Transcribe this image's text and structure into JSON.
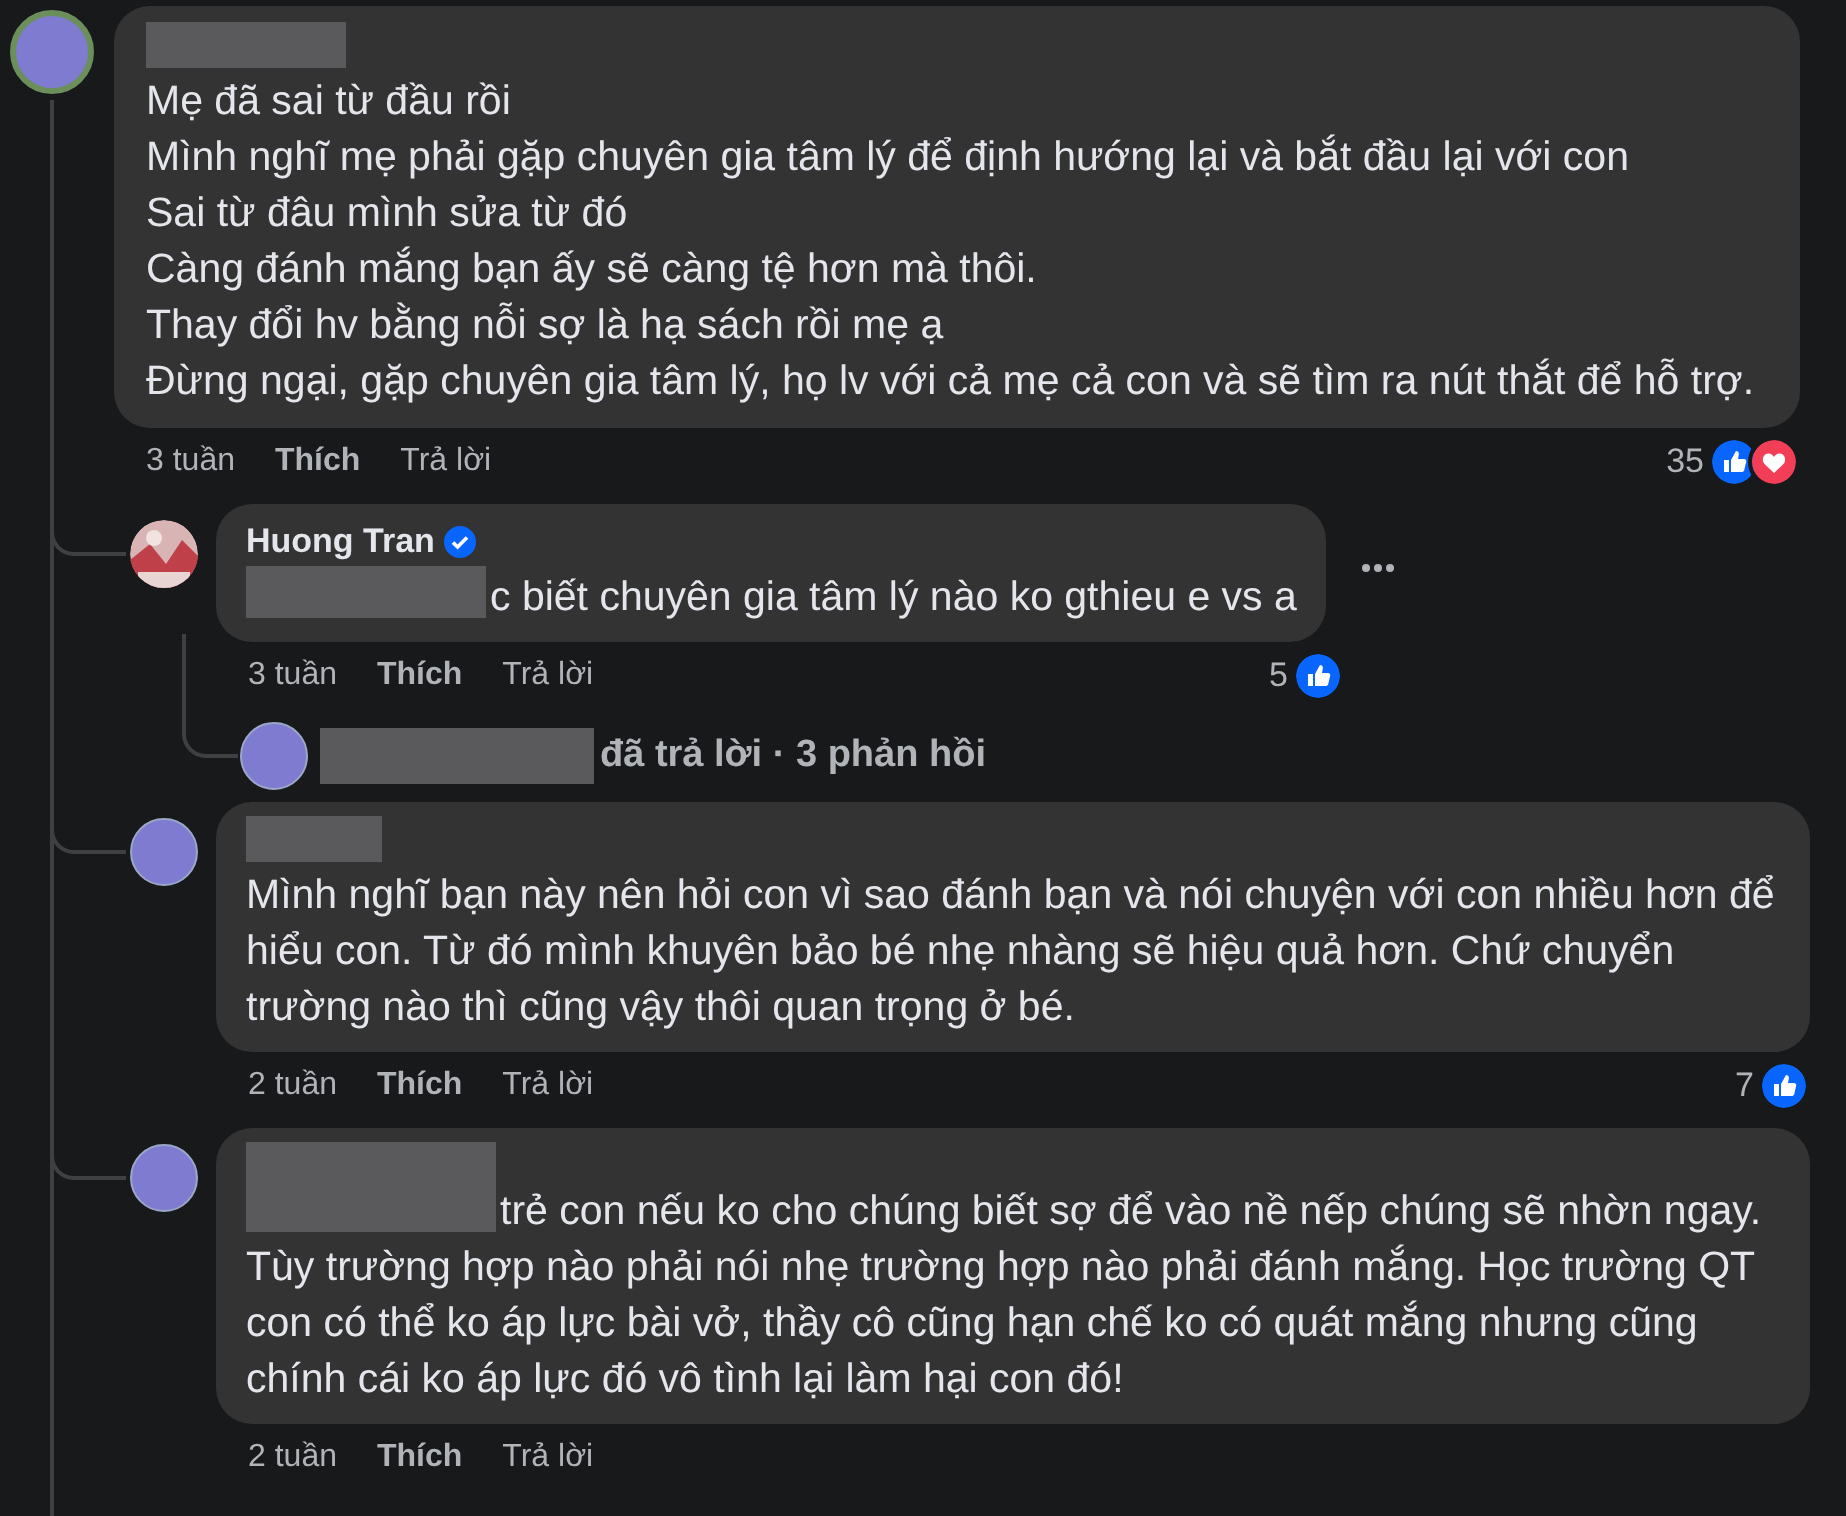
{
  "comment": {
    "name_hidden": true,
    "lines": [
      "Mẹ đã sai từ đầu rồi",
      "Mình nghĩ mẹ phải gặp chuyên gia tâm lý để định hướng lại và bắt đầu lại với con",
      "Sai từ đâu mình sửa từ đó",
      "Càng đánh mắng bạn ấy sẽ càng tệ hơn mà thôi.",
      "Thay đổi hv bằng nỗi sợ là hạ sách rồi mẹ ạ",
      "Đừng ngại, gặp chuyên gia tâm lý, họ lv với cả mẹ cả con và sẽ tìm ra nút thắt để hỗ trợ."
    ],
    "time": "3 tuần",
    "like": "Thích",
    "reply": "Trả lời",
    "reaction_count": "35",
    "reactions": [
      {
        "kind": "like"
      },
      {
        "kind": "love"
      }
    ]
  },
  "replies": [
    {
      "author": "Huong Tran",
      "verified": true,
      "name_hidden": false,
      "prefix_hidden": true,
      "text": "c biết chuyên gia tâm lý nào ko gthieu e vs a",
      "more": true,
      "time": "3 tuần",
      "like": "Thích",
      "reply": "Trả lời",
      "reaction_count": "5",
      "reactions": [
        {
          "kind": "like"
        }
      ],
      "summary": {
        "text": "đã trả lời · 3 phản hồi"
      }
    },
    {
      "name_hidden": true,
      "verified": false,
      "prefix_hidden": false,
      "text": "Mình nghĩ bạn này nên hỏi con vì sao đánh bạn và nói chuyện với con nhiều hơn để hiểu con. Từ đó mình khuyên bảo bé nhẹ nhàng sẽ hiệu quả hơn. Chứ chuyển trường nào thì cũng vậy thôi quan trọng ở bé.",
      "more": false,
      "time": "2 tuần",
      "like": "Thích",
      "reply": "Trả lời",
      "reaction_count": "7",
      "reactions": [
        {
          "kind": "like"
        }
      ]
    },
    {
      "name_hidden": false,
      "verified": false,
      "prefix_hidden": true,
      "text": "trẻ con nếu ko cho chúng biết sợ để vào nề nếp chúng sẽ nhờn ngay. Tùy trường hợp nào phải nói nhẹ trường hợp nào phải đánh mắng. Học trường QT con có thể ko áp lực bài vở, thầy cô cũng hạn chế ko có quát mắng nhưng cũng chính cái ko áp lực đó vô tình lại làm hại con đó!",
      "more": false,
      "time": "2 tuần",
      "like": "Thích",
      "reply": "Trả lời"
    }
  ]
}
